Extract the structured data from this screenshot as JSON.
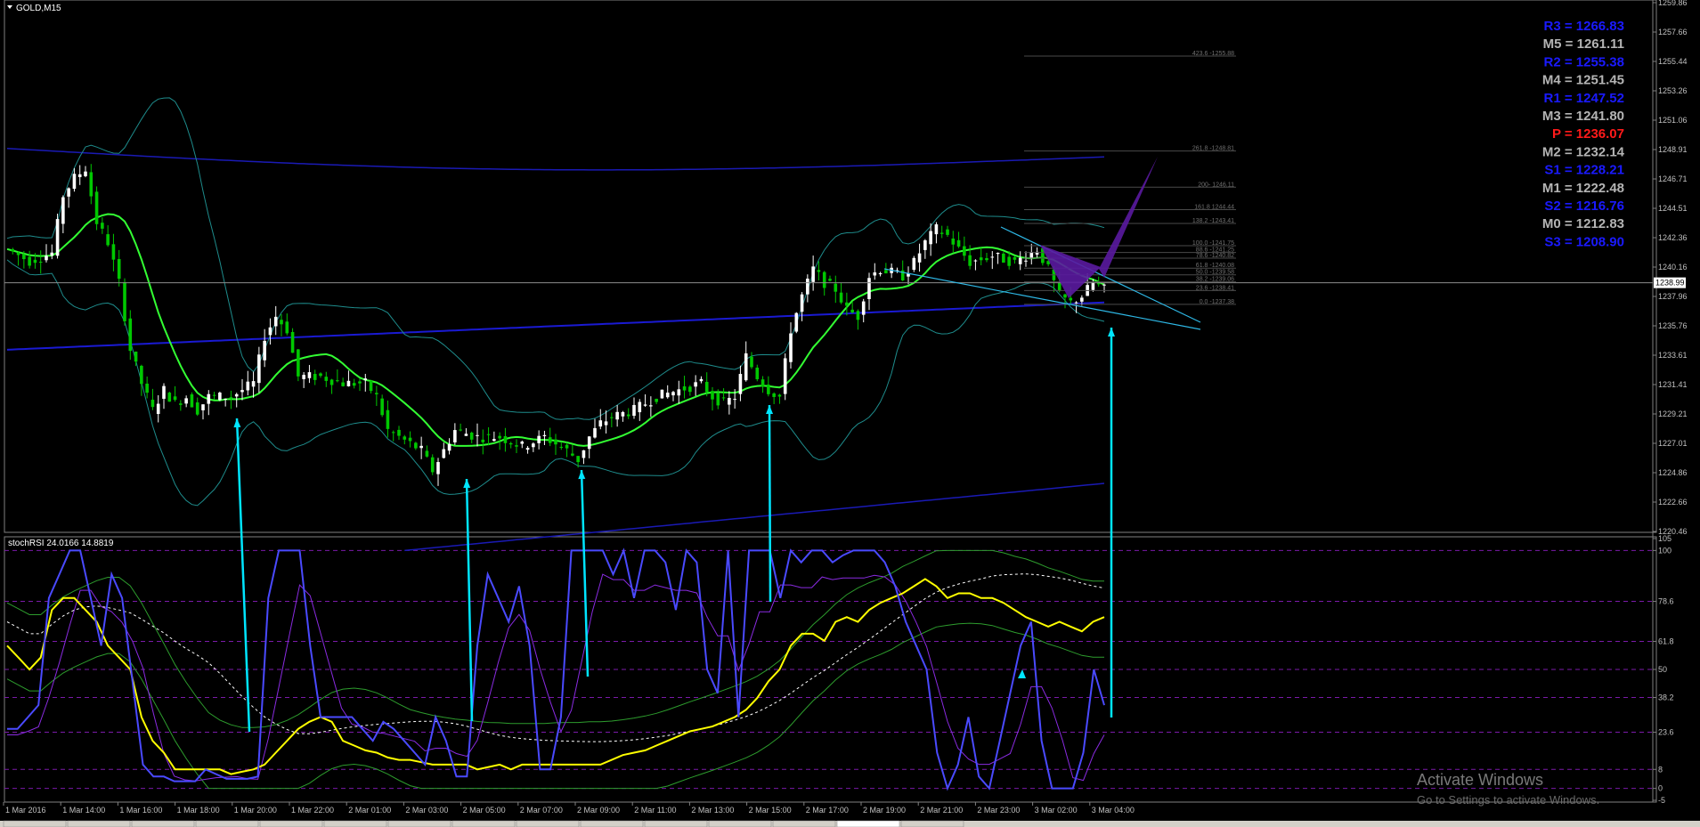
{
  "window": {
    "title": "GOLD,M15"
  },
  "indicator": {
    "title": "stochRSI 24.0166 14.8819"
  },
  "main_axis": {
    "ticks": [
      "1259.86",
      "1257.66",
      "1255.44",
      "1253.26",
      "1251.06",
      "1248.91",
      "1246.71",
      "1244.51",
      "1242.36",
      "1240.16",
      "1237.96",
      "1235.76",
      "1233.61",
      "1231.41",
      "1229.21",
      "1227.01",
      "1224.86",
      "1222.66",
      "1220.46"
    ],
    "current_price": "1238.99"
  },
  "sub_axis": {
    "ticks": [
      "105",
      "100",
      "78.6",
      "61.8",
      "50",
      "38.2",
      "23.6",
      "8",
      "0",
      "-5"
    ]
  },
  "time_axis": {
    "labels": [
      "1 Mar 2016",
      "1 Mar 14:00",
      "1 Mar 16:00",
      "1 Mar 18:00",
      "1 Mar 20:00",
      "1 Mar 22:00",
      "2 Mar 01:00",
      "2 Mar 03:00",
      "2 Mar 05:00",
      "2 Mar 07:00",
      "2 Mar 09:00",
      "2 Mar 11:00",
      "2 Mar 13:00",
      "2 Mar 15:00",
      "2 Mar 17:00",
      "2 Mar 19:00",
      "2 Mar 21:00",
      "2 Mar 23:00",
      "3 Mar 02:00",
      "3 Mar 04:00"
    ]
  },
  "fib_levels": [
    "423.6 -1255.88",
    "261.8 -1248.81",
    "200- 1246.11",
    "161.8 1244.44",
    "138.2 -1243.41",
    "100.0 -1241.75",
    "88.6 -1241.25",
    "78.6 -1240.82",
    "61.8 -1240.08",
    "50.0 -1239.58",
    "38.2 -1239.06",
    "23.6 -1238.41",
    "0.0 -1237.38"
  ],
  "pivots": [
    {
      "text": "R3 = 1266.83",
      "color": "#1a1aff"
    },
    {
      "text": "M5 = 1261.11",
      "color": "#b4b4b4"
    },
    {
      "text": "R2 = 1255.38",
      "color": "#1a1aff"
    },
    {
      "text": "M4 = 1251.45",
      "color": "#b4b4b4"
    },
    {
      "text": "R1 = 1247.52",
      "color": "#1a1aff"
    },
    {
      "text": "M3 = 1241.80",
      "color": "#b4b4b4"
    },
    {
      "text": "P  = 1236.07",
      "color": "#ff1a1a"
    },
    {
      "text": "M2 = 1232.14",
      "color": "#b4b4b4"
    },
    {
      "text": "S1 = 1228.21",
      "color": "#1a1aff"
    },
    {
      "text": "M1 = 1222.48",
      "color": "#b4b4b4"
    },
    {
      "text": "S2 = 1216.76",
      "color": "#1a1aff"
    },
    {
      "text": "M0 = 1212.83",
      "color": "#b4b4b4"
    },
    {
      "text": "S3 = 1208.90",
      "color": "#1a1aff"
    }
  ],
  "watermark": {
    "line1": "Activate Windows",
    "line2": "Go to Settings to activate Windows."
  },
  "colors": {
    "background": "#000000",
    "bull": "#ffffff",
    "bear": "#00c800",
    "ma": "#33ff33",
    "band": "#1a1ab4",
    "bb": "#1e8c8c",
    "arrow": "#00e5ff",
    "stoch_k": "#4040ff",
    "stoch_d": "#ffff00"
  },
  "chart_data": [
    {
      "type": "candlestick",
      "symbol": "GOLD",
      "timeframe": "M15",
      "ylim": [
        1220.46,
        1259.86
      ],
      "close_path": [
        [
          0,
          1241.5
        ],
        [
          4,
          1240.6
        ],
        [
          8,
          1241.2
        ],
        [
          10,
          1245.5
        ],
        [
          12,
          1246.8
        ],
        [
          14,
          1247.5
        ],
        [
          16,
          1243.5
        ],
        [
          18,
          1242.0
        ],
        [
          20,
          1239.0
        ],
        [
          22,
          1234.0
        ],
        [
          24,
          1231.5
        ],
        [
          26,
          1229.5
        ],
        [
          28,
          1231.0
        ],
        [
          30,
          1230.0
        ],
        [
          32,
          1230.5
        ],
        [
          34,
          1229.5
        ],
        [
          36,
          1230.5
        ],
        [
          40,
          1230.5
        ],
        [
          44,
          1231.5
        ],
        [
          46,
          1235.0
        ],
        [
          48,
          1236.5
        ],
        [
          50,
          1235.5
        ],
        [
          52,
          1232.0
        ],
        [
          56,
          1232.0
        ],
        [
          60,
          1231.5
        ],
        [
          64,
          1231.5
        ],
        [
          66,
          1230.5
        ],
        [
          68,
          1228.0
        ],
        [
          70,
          1227.5
        ],
        [
          72,
          1227.0
        ],
        [
          74,
          1226.5
        ],
        [
          76,
          1225.0
        ],
        [
          78,
          1226.5
        ],
        [
          80,
          1228.0
        ],
        [
          84,
          1227.5
        ],
        [
          88,
          1227.5
        ],
        [
          92,
          1226.8
        ],
        [
          96,
          1227.5
        ],
        [
          100,
          1226.5
        ],
        [
          102,
          1225.8
        ],
        [
          104,
          1227.5
        ],
        [
          106,
          1228.5
        ],
        [
          108,
          1229.0
        ],
        [
          112,
          1229.5
        ],
        [
          116,
          1230.5
        ],
        [
          120,
          1231.0
        ],
        [
          124,
          1231.5
        ],
        [
          126,
          1230.5
        ],
        [
          128,
          1230.0
        ],
        [
          130,
          1230.5
        ],
        [
          132,
          1233.5
        ],
        [
          134,
          1232.0
        ],
        [
          136,
          1231.0
        ],
        [
          138,
          1230.5
        ],
        [
          140,
          1235.5
        ],
        [
          142,
          1238.0
        ],
        [
          144,
          1240.0
        ],
        [
          146,
          1239.0
        ],
        [
          148,
          1238.5
        ],
        [
          150,
          1237.0
        ],
        [
          152,
          1236.5
        ],
        [
          154,
          1239.5
        ],
        [
          156,
          1240.0
        ],
        [
          160,
          1239.5
        ],
        [
          162,
          1240.5
        ],
        [
          164,
          1242.0
        ],
        [
          166,
          1243.0
        ],
        [
          168,
          1242.5
        ],
        [
          170,
          1241.5
        ],
        [
          172,
          1240.5
        ],
        [
          176,
          1241.0
        ],
        [
          180,
          1240.5
        ],
        [
          184,
          1241.5
        ],
        [
          186,
          1240.0
        ],
        [
          188,
          1238.0
        ],
        [
          190,
          1237.5
        ],
        [
          192,
          1238.0
        ],
        [
          194,
          1239.0
        ],
        [
          196,
          1238.5
        ]
      ]
    },
    {
      "type": "line",
      "title": "stochRSI 24.0166 14.8819",
      "ylim": [
        -5,
        105
      ],
      "levels": [
        100,
        78.6,
        61.8,
        50,
        38.2,
        23.6,
        8,
        0
      ],
      "series": [
        {
          "values": [
            25,
            25,
            30,
            35,
            80,
            90,
            100,
            100,
            80,
            60,
            90,
            80,
            45,
            10,
            5,
            5,
            3,
            3,
            3,
            8,
            6,
            4,
            4,
            4,
            5,
            80,
            100,
            100,
            100,
            60,
            30,
            30,
            30,
            30,
            25,
            20,
            28,
            25,
            20,
            15,
            10,
            30,
            20,
            5,
            5,
            60,
            90,
            80,
            70,
            85,
            60,
            8,
            8,
            30,
            100,
            100,
            100,
            100,
            90,
            100,
            80,
            100,
            100,
            95,
            75,
            100,
            95,
            50,
            40,
            100,
            30,
            100,
            100,
            100,
            80,
            100,
            95,
            100,
            100,
            95,
            98,
            100,
            100,
            100,
            95,
            85,
            70,
            60,
            50,
            15,
            0,
            10,
            30,
            5,
            0,
            20,
            40,
            60,
            70,
            20,
            0,
            0,
            0,
            15,
            50,
            35
          ]
        },
        {
          "values": [
            60,
            55,
            50,
            55,
            75,
            80,
            80,
            75,
            70,
            60,
            55,
            50,
            30,
            20,
            15,
            8,
            8,
            8,
            8,
            8,
            6,
            7,
            8,
            10,
            15,
            20,
            25,
            28,
            30,
            28,
            20,
            18,
            16,
            15,
            13,
            12,
            12,
            11,
            10,
            10,
            10,
            10,
            8,
            9,
            10,
            8,
            10,
            10,
            10,
            10,
            10,
            10,
            10,
            10,
            12,
            14,
            15,
            16,
            18,
            20,
            22,
            24,
            25,
            26,
            28,
            30,
            33,
            38,
            45,
            50,
            60,
            65,
            65,
            62,
            70,
            72,
            70,
            75,
            78,
            80,
            82,
            85,
            88,
            85,
            80,
            82,
            82,
            80,
            80,
            78,
            75,
            72,
            70,
            68,
            70,
            68,
            66,
            70,
            72
          ]
        }
      ]
    }
  ]
}
